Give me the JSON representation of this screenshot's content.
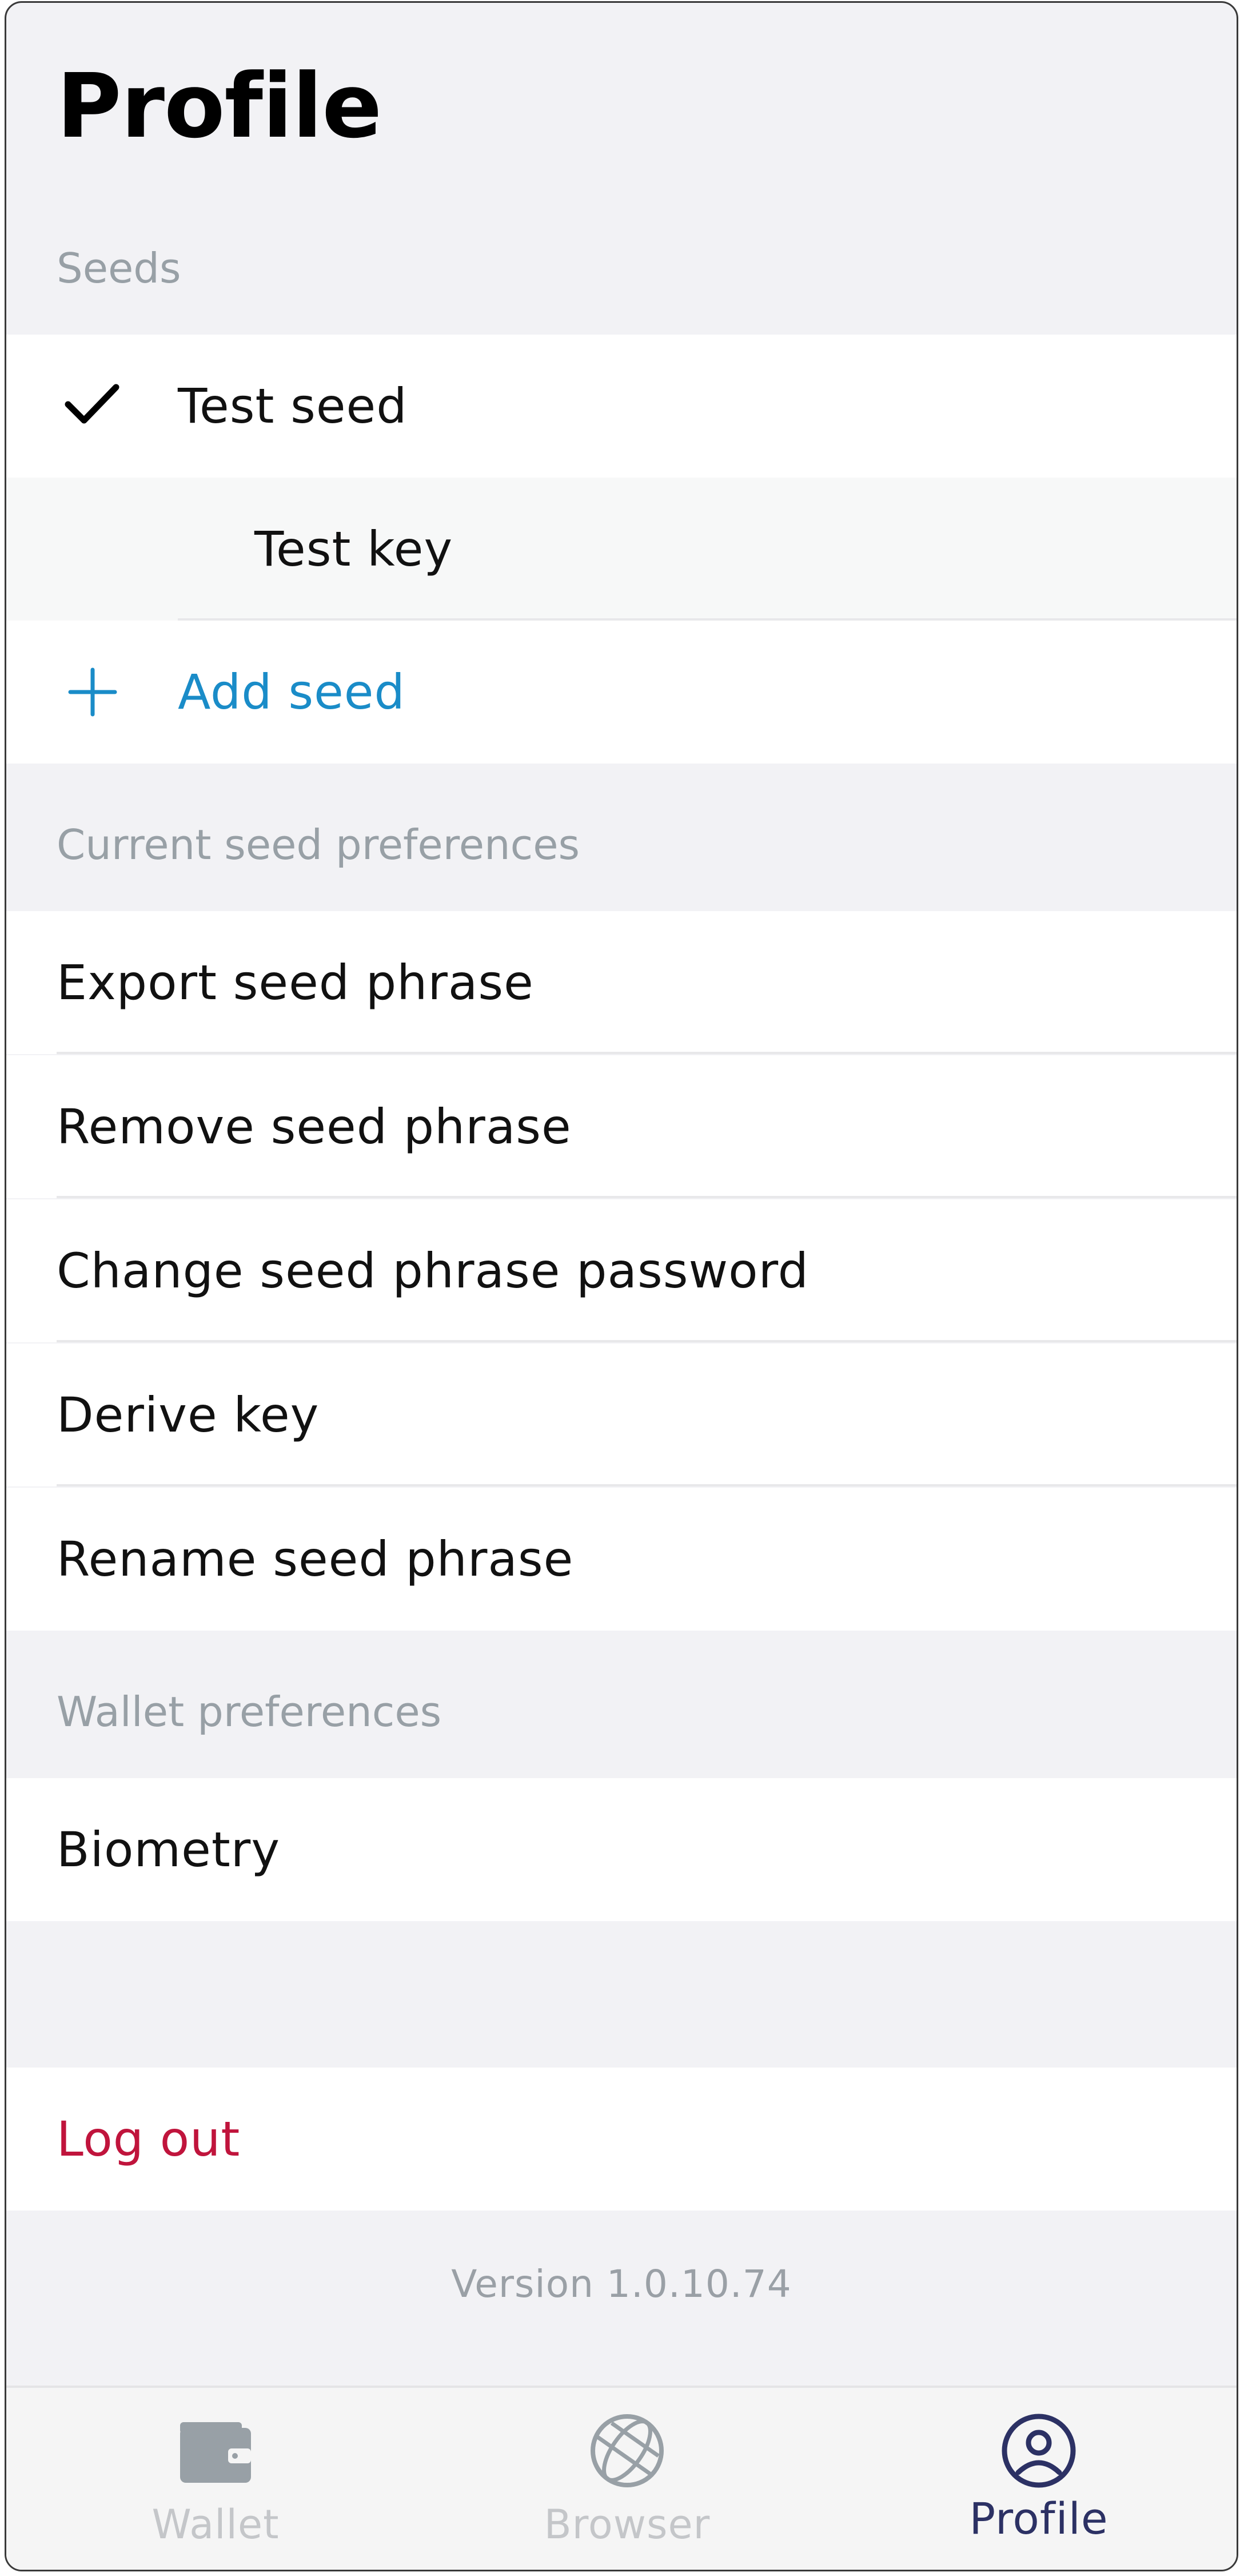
{
  "header": {
    "title": "Profile"
  },
  "seeds": {
    "section_label": "Seeds",
    "selected_seed": "Test seed",
    "key": "Test key",
    "add_label": "Add seed"
  },
  "current_seed_preferences": {
    "section_label": "Current seed preferences",
    "items": [
      {
        "label": "Export seed phrase"
      },
      {
        "label": "Remove seed phrase"
      },
      {
        "label": "Change seed phrase password"
      },
      {
        "label": "Derive key"
      },
      {
        "label": "Rename seed phrase"
      }
    ]
  },
  "wallet_preferences": {
    "section_label": "Wallet preferences",
    "items": [
      {
        "label": "Biometry"
      }
    ]
  },
  "logout": {
    "label": "Log out"
  },
  "version": "Version 1.0.10.74",
  "tabs": [
    {
      "label": "Wallet",
      "icon": "wallet-icon",
      "active": false
    },
    {
      "label": "Browser",
      "icon": "globe-icon",
      "active": false
    },
    {
      "label": "Profile",
      "icon": "user-circle-icon",
      "active": true
    }
  ],
  "colors": {
    "accent": "#1a8cc8",
    "danger": "#c0143c",
    "section_text": "#98a0a6",
    "active_tab": "#2c3164",
    "inactive_tab": "#c4c6c9"
  }
}
